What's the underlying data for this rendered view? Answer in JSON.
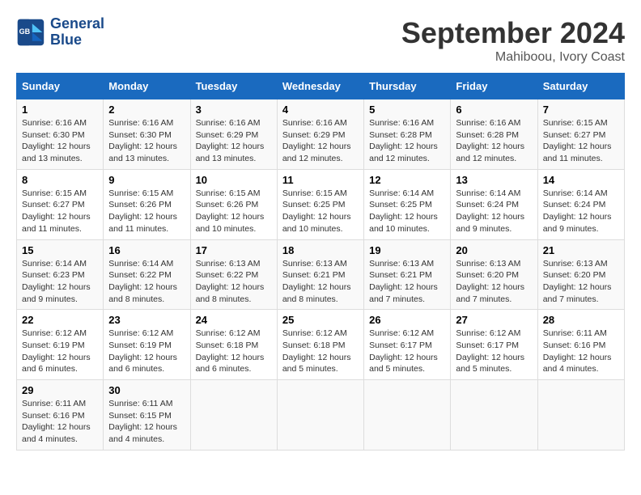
{
  "header": {
    "logo_line1": "General",
    "logo_line2": "Blue",
    "month": "September 2024",
    "location": "Mahiboou, Ivory Coast"
  },
  "days_of_week": [
    "Sunday",
    "Monday",
    "Tuesday",
    "Wednesday",
    "Thursday",
    "Friday",
    "Saturday"
  ],
  "weeks": [
    [
      {
        "day": "1",
        "info": "Sunrise: 6:16 AM\nSunset: 6:30 PM\nDaylight: 12 hours\nand 13 minutes."
      },
      {
        "day": "2",
        "info": "Sunrise: 6:16 AM\nSunset: 6:30 PM\nDaylight: 12 hours\nand 13 minutes."
      },
      {
        "day": "3",
        "info": "Sunrise: 6:16 AM\nSunset: 6:29 PM\nDaylight: 12 hours\nand 13 minutes."
      },
      {
        "day": "4",
        "info": "Sunrise: 6:16 AM\nSunset: 6:29 PM\nDaylight: 12 hours\nand 12 minutes."
      },
      {
        "day": "5",
        "info": "Sunrise: 6:16 AM\nSunset: 6:28 PM\nDaylight: 12 hours\nand 12 minutes."
      },
      {
        "day": "6",
        "info": "Sunrise: 6:16 AM\nSunset: 6:28 PM\nDaylight: 12 hours\nand 12 minutes."
      },
      {
        "day": "7",
        "info": "Sunrise: 6:15 AM\nSunset: 6:27 PM\nDaylight: 12 hours\nand 11 minutes."
      }
    ],
    [
      {
        "day": "8",
        "info": "Sunrise: 6:15 AM\nSunset: 6:27 PM\nDaylight: 12 hours\nand 11 minutes."
      },
      {
        "day": "9",
        "info": "Sunrise: 6:15 AM\nSunset: 6:26 PM\nDaylight: 12 hours\nand 11 minutes."
      },
      {
        "day": "10",
        "info": "Sunrise: 6:15 AM\nSunset: 6:26 PM\nDaylight: 12 hours\nand 10 minutes."
      },
      {
        "day": "11",
        "info": "Sunrise: 6:15 AM\nSunset: 6:25 PM\nDaylight: 12 hours\nand 10 minutes."
      },
      {
        "day": "12",
        "info": "Sunrise: 6:14 AM\nSunset: 6:25 PM\nDaylight: 12 hours\nand 10 minutes."
      },
      {
        "day": "13",
        "info": "Sunrise: 6:14 AM\nSunset: 6:24 PM\nDaylight: 12 hours\nand 9 minutes."
      },
      {
        "day": "14",
        "info": "Sunrise: 6:14 AM\nSunset: 6:24 PM\nDaylight: 12 hours\nand 9 minutes."
      }
    ],
    [
      {
        "day": "15",
        "info": "Sunrise: 6:14 AM\nSunset: 6:23 PM\nDaylight: 12 hours\nand 9 minutes."
      },
      {
        "day": "16",
        "info": "Sunrise: 6:14 AM\nSunset: 6:22 PM\nDaylight: 12 hours\nand 8 minutes."
      },
      {
        "day": "17",
        "info": "Sunrise: 6:13 AM\nSunset: 6:22 PM\nDaylight: 12 hours\nand 8 minutes."
      },
      {
        "day": "18",
        "info": "Sunrise: 6:13 AM\nSunset: 6:21 PM\nDaylight: 12 hours\nand 8 minutes."
      },
      {
        "day": "19",
        "info": "Sunrise: 6:13 AM\nSunset: 6:21 PM\nDaylight: 12 hours\nand 7 minutes."
      },
      {
        "day": "20",
        "info": "Sunrise: 6:13 AM\nSunset: 6:20 PM\nDaylight: 12 hours\nand 7 minutes."
      },
      {
        "day": "21",
        "info": "Sunrise: 6:13 AM\nSunset: 6:20 PM\nDaylight: 12 hours\nand 7 minutes."
      }
    ],
    [
      {
        "day": "22",
        "info": "Sunrise: 6:12 AM\nSunset: 6:19 PM\nDaylight: 12 hours\nand 6 minutes."
      },
      {
        "day": "23",
        "info": "Sunrise: 6:12 AM\nSunset: 6:19 PM\nDaylight: 12 hours\nand 6 minutes."
      },
      {
        "day": "24",
        "info": "Sunrise: 6:12 AM\nSunset: 6:18 PM\nDaylight: 12 hours\nand 6 minutes."
      },
      {
        "day": "25",
        "info": "Sunrise: 6:12 AM\nSunset: 6:18 PM\nDaylight: 12 hours\nand 5 minutes."
      },
      {
        "day": "26",
        "info": "Sunrise: 6:12 AM\nSunset: 6:17 PM\nDaylight: 12 hours\nand 5 minutes."
      },
      {
        "day": "27",
        "info": "Sunrise: 6:12 AM\nSunset: 6:17 PM\nDaylight: 12 hours\nand 5 minutes."
      },
      {
        "day": "28",
        "info": "Sunrise: 6:11 AM\nSunset: 6:16 PM\nDaylight: 12 hours\nand 4 minutes."
      }
    ],
    [
      {
        "day": "29",
        "info": "Sunrise: 6:11 AM\nSunset: 6:16 PM\nDaylight: 12 hours\nand 4 minutes."
      },
      {
        "day": "30",
        "info": "Sunrise: 6:11 AM\nSunset: 6:15 PM\nDaylight: 12 hours\nand 4 minutes."
      },
      {
        "day": "",
        "info": ""
      },
      {
        "day": "",
        "info": ""
      },
      {
        "day": "",
        "info": ""
      },
      {
        "day": "",
        "info": ""
      },
      {
        "day": "",
        "info": ""
      }
    ]
  ]
}
